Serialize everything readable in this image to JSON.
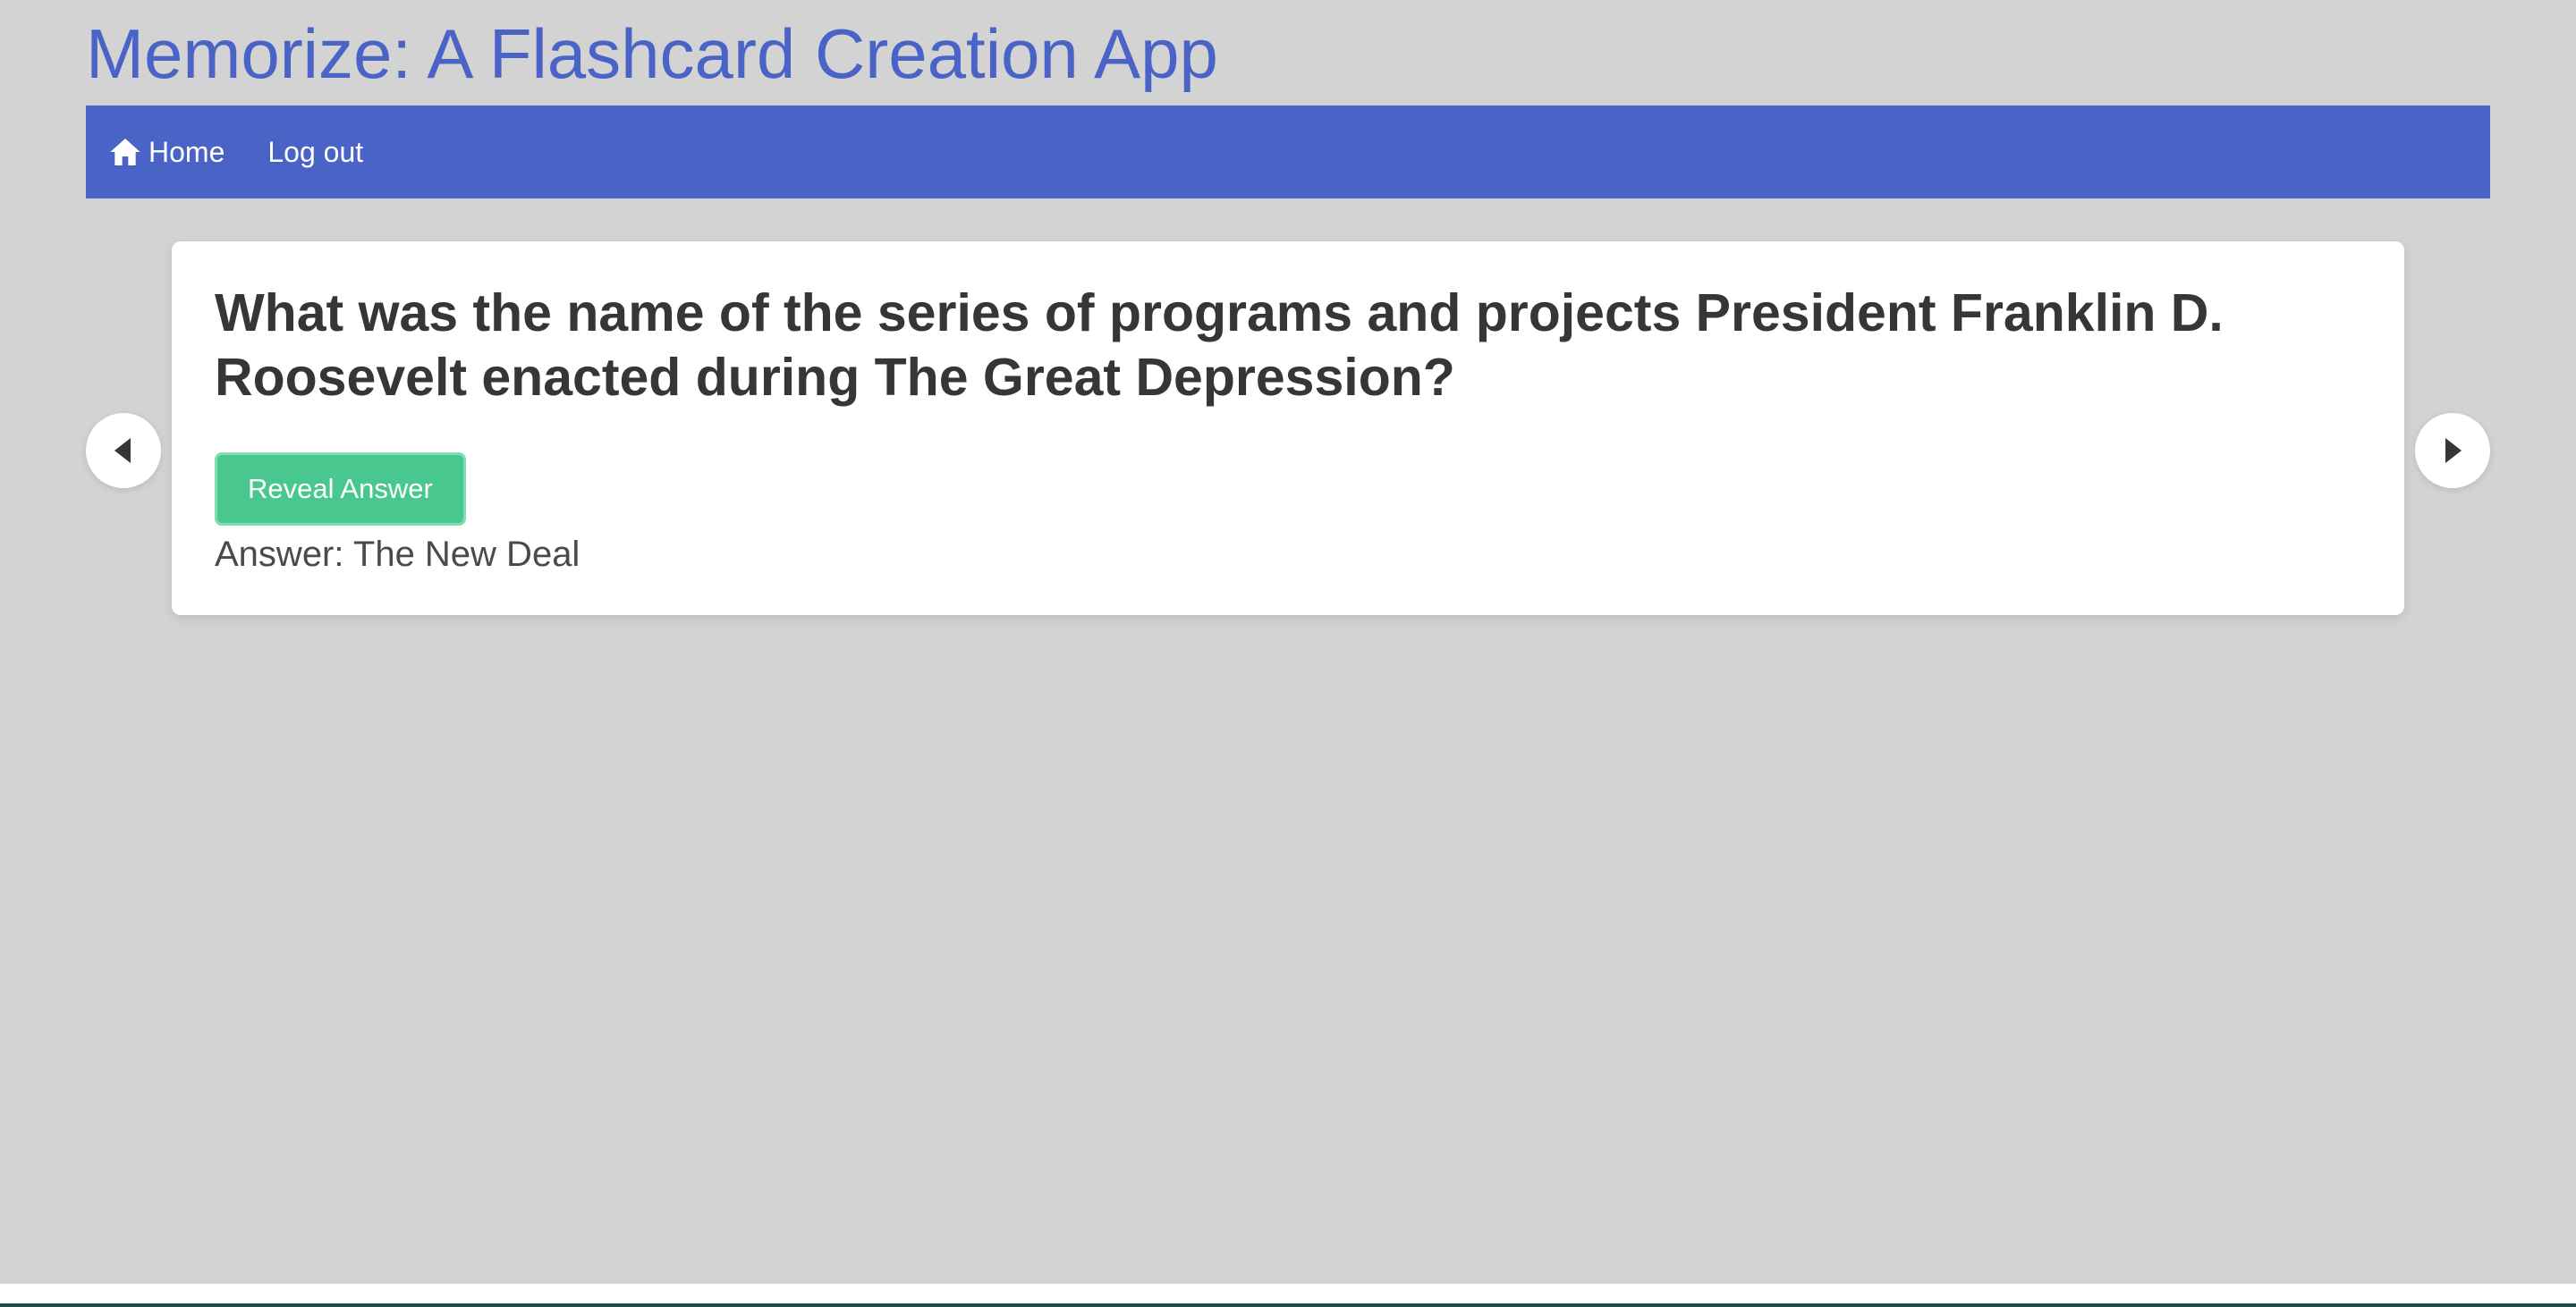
{
  "app": {
    "title": "Memorize: A Flashcard Creation App"
  },
  "nav": {
    "home_label": "Home",
    "home_icon": "home-icon",
    "logout_label": "Log out"
  },
  "card": {
    "question": "What was the name of the series of programs and projects President Franklin D. Roosevelt enacted during The Great Depression?",
    "reveal_button_label": "Reveal Answer",
    "answer": "Answer: The New Deal"
  },
  "controls": {
    "prev_icon": "caret-left-icon",
    "next_icon": "caret-right-icon"
  },
  "colors": {
    "background": "#d3d3d3",
    "brand": "#4a63c6",
    "reveal_button": "#48c78e",
    "card": "#ffffff",
    "text": "#363636"
  }
}
